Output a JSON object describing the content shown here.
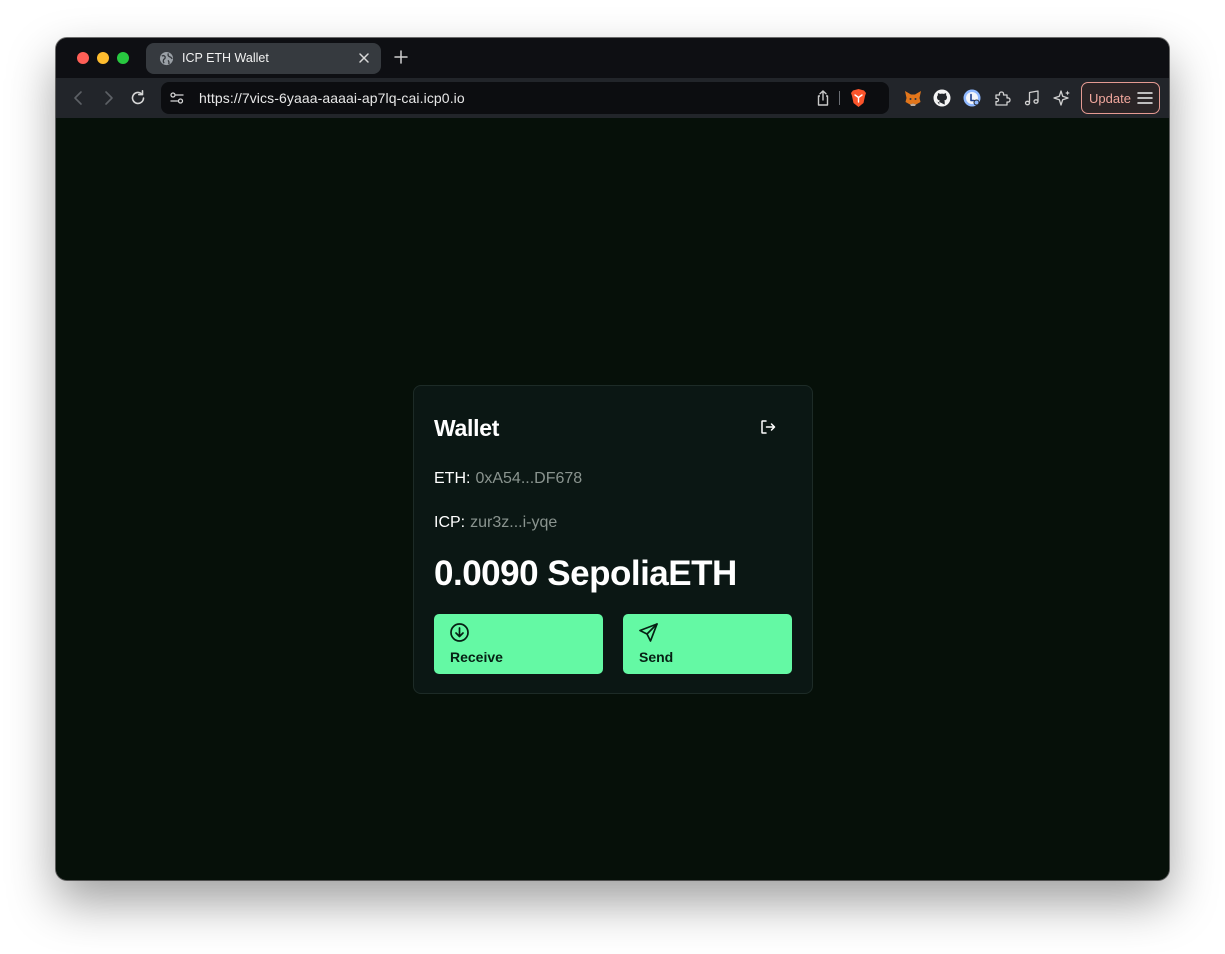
{
  "browser": {
    "tab": {
      "title": "ICP ETH Wallet",
      "icon": "globe-icon"
    },
    "url": "https://7vics-6yaaa-aaaai-ap7lq-cai.icp0.io",
    "update_label": "Update",
    "toolbar_icons": [
      "back-icon",
      "forward-icon",
      "reload-icon",
      "site-settings-icon",
      "share-icon",
      "brave-shields-icon",
      "metamask-extension-icon",
      "github-extension-icon",
      "ic-extension-icon",
      "extensions-puzzle-icon",
      "media-music-icon",
      "leo-ai-icon",
      "hamburger-menu-icon"
    ]
  },
  "wallet": {
    "title": "Wallet",
    "eth_label": "ETH:",
    "eth_address": "0xA54...DF678",
    "icp_label": "ICP:",
    "icp_principal": "zur3z...i-yqe",
    "balance": "0.0090 SepoliaETH",
    "receive_label": "Receive",
    "send_label": "Send"
  },
  "colors": {
    "page_background": "#061009",
    "card_background": "#0b1714",
    "accent": "#64f9a4",
    "update_accent": "#f1a79d"
  }
}
